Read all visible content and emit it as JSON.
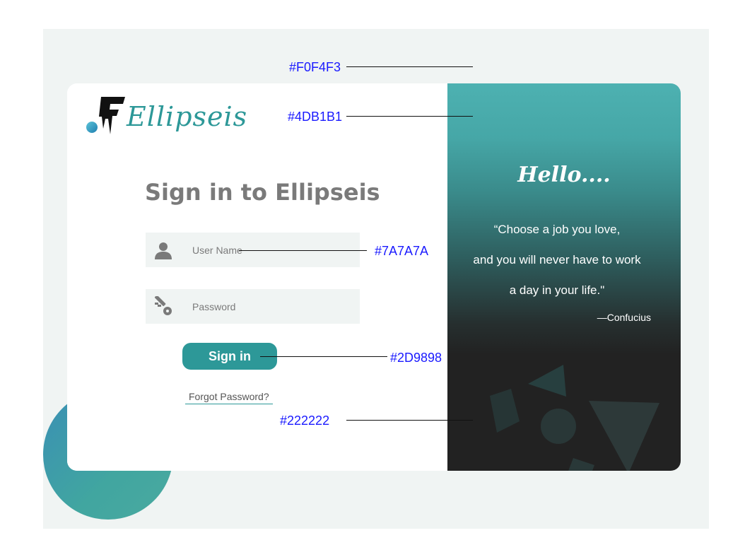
{
  "brand": {
    "logo_text": "Ellipseis",
    "accent": "#2D9898",
    "gradient_top": "#4DB1B1",
    "dark": "#222222",
    "background": "#F0F4F3",
    "muted_text": "#7A7A7A"
  },
  "form": {
    "title": "Sign in to Ellipseis",
    "username": {
      "placeholder": "User Name",
      "icon": "user-icon"
    },
    "password": {
      "placeholder": "Password",
      "icon": "key-icon"
    },
    "submit_label": "Sign in",
    "forgot_label": "Forgot Password?"
  },
  "panel": {
    "greeting": "Hello....",
    "quote_lines": [
      "“Choose a job you love,",
      "and you will never have to work",
      "a day in your life.\""
    ],
    "attribution": "—Confucius"
  },
  "annotations": [
    {
      "label": "#F0F4F3"
    },
    {
      "label": "#4DB1B1"
    },
    {
      "label": "#7A7A7A"
    },
    {
      "label": "#2D9898"
    },
    {
      "label": "#222222"
    }
  ]
}
